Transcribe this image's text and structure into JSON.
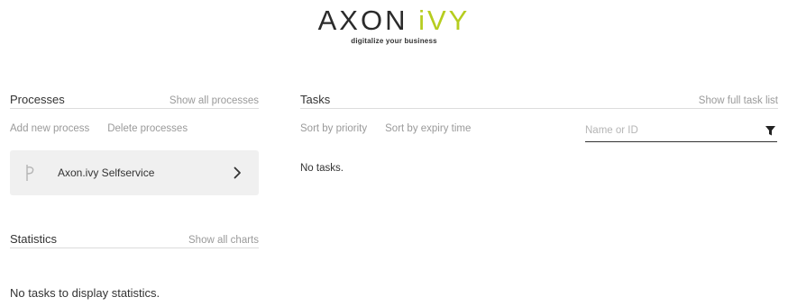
{
  "header": {
    "logo_axon": "AXON",
    "logo_ivy": "iVY",
    "tagline": "digitalize your business"
  },
  "processes": {
    "title": "Processes",
    "show_all_link": "Show all processes",
    "add_label": "Add new process",
    "delete_label": "Delete processes",
    "items": [
      {
        "label": "Axon.ivy Selfservice",
        "icon": "process-icon"
      }
    ]
  },
  "tasks": {
    "title": "Tasks",
    "show_full_link": "Show full task list",
    "sort_priority": "Sort by priority",
    "sort_expiry": "Sort by expiry time",
    "filter_placeholder": "Name or ID",
    "filter_value": "",
    "filter_icon": "funnel-icon",
    "empty_text": "No tasks."
  },
  "statistics": {
    "title": "Statistics",
    "show_all_link": "Show all charts",
    "empty_text": "No tasks to display statistics."
  },
  "colors": {
    "brand_dark": "#2b2b2b",
    "brand_accent": "#b6cd1f",
    "muted_text": "#9a9a9a",
    "card_bg": "#f0f0f0"
  }
}
